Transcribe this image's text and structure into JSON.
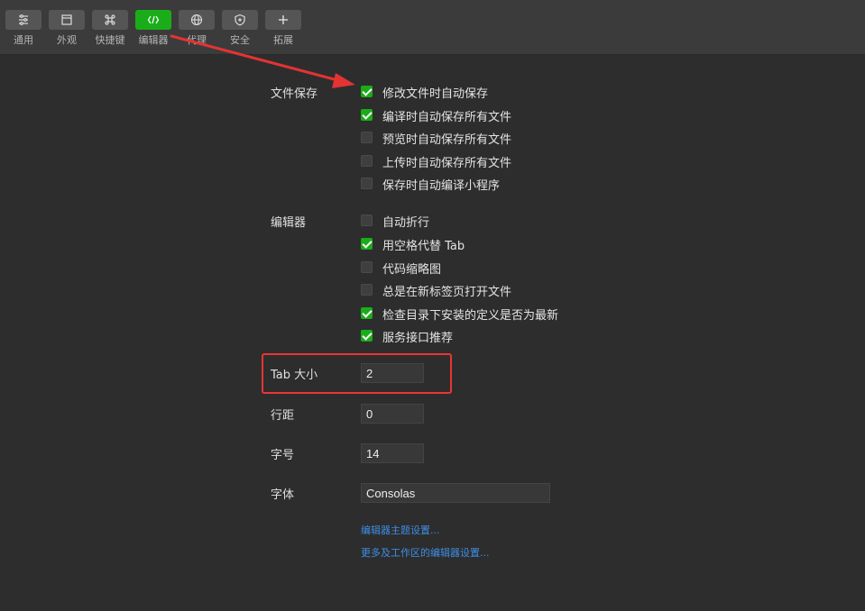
{
  "toolbar": {
    "items": [
      {
        "label": "通用",
        "icon": "sliders-icon"
      },
      {
        "label": "外观",
        "icon": "window-icon"
      },
      {
        "label": "快捷键",
        "icon": "command-key-icon"
      },
      {
        "label": "编辑器",
        "icon": "code-icon",
        "active": true
      },
      {
        "label": "代理",
        "icon": "globe-icon"
      },
      {
        "label": "安全",
        "icon": "shield-icon"
      },
      {
        "label": "拓展",
        "icon": "plus-icon"
      }
    ],
    "active_color": "#1aad19"
  },
  "file_save": {
    "label": "文件保存",
    "options": [
      {
        "label": "修改文件时自动保存",
        "checked": true
      },
      {
        "label": "编译时自动保存所有文件",
        "checked": true
      },
      {
        "label": "预览时自动保存所有文件",
        "checked": false
      },
      {
        "label": "上传时自动保存所有文件",
        "checked": false
      },
      {
        "label": "保存时自动编译小程序",
        "checked": false
      }
    ]
  },
  "editor": {
    "label": "编辑器",
    "options": [
      {
        "label": "自动折行",
        "checked": false
      },
      {
        "label": "用空格代替 Tab",
        "checked": true
      },
      {
        "label": "代码缩略图",
        "checked": false
      },
      {
        "label": "总是在新标签页打开文件",
        "checked": false
      },
      {
        "label": "检查目录下安装的定义是否为最新",
        "checked": true
      },
      {
        "label": "服务接口推荐",
        "checked": true
      }
    ]
  },
  "fields": {
    "tab_size": {
      "label": "Tab 大小",
      "value": "2"
    },
    "line_height": {
      "label": "行距",
      "value": "0"
    },
    "font_size": {
      "label": "字号",
      "value": "14"
    },
    "font_family": {
      "label": "字体",
      "value": "Consolas"
    }
  },
  "links": {
    "theme": "编辑器主题设置...",
    "more": "更多及工作区的编辑器设置..."
  },
  "annotation_color": "#e33333"
}
